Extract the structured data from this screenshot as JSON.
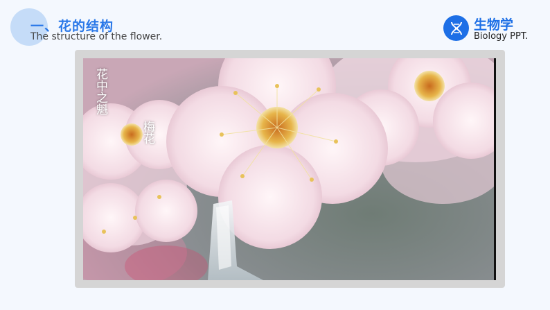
{
  "header": {
    "title_cn": "一、花的结构",
    "title_en": "The structure of the flower."
  },
  "brand": {
    "name_cn": "生物学",
    "name_en": "Biology PPT.",
    "icon": "dna-icon",
    "color": "#1d6fe6"
  },
  "photo": {
    "caption_line1": "花中之魁",
    "caption_line2": "梅花"
  }
}
